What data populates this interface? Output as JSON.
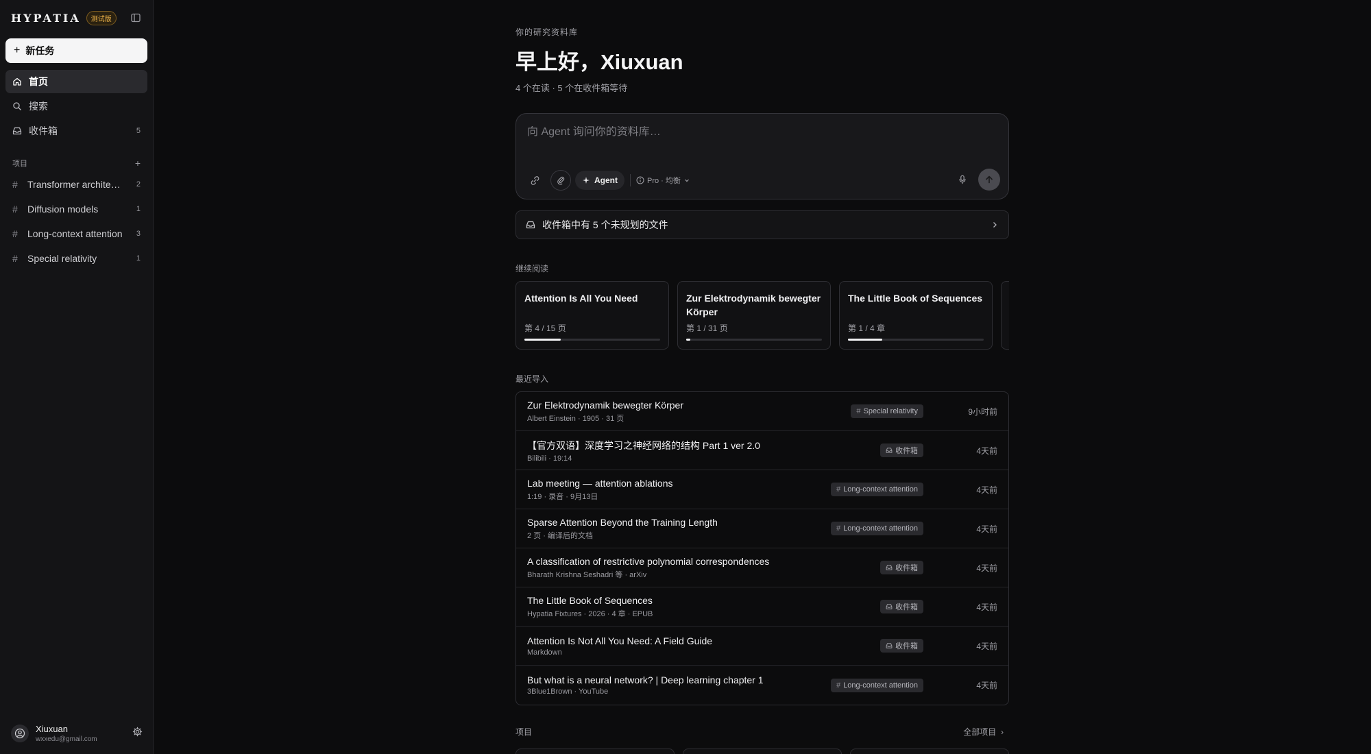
{
  "brand": {
    "logo": "HYPATIA",
    "badge": "测试版"
  },
  "sidebar": {
    "new_task": "新任务",
    "nav": [
      {
        "label": "首页",
        "icon": "home-icon",
        "active": true
      },
      {
        "label": "搜索",
        "icon": "search-icon"
      },
      {
        "label": "收件箱",
        "icon": "inbox-icon",
        "count": "5"
      }
    ],
    "projects_heading": "项目",
    "projects": [
      {
        "name": "Transformer architecture",
        "count": "2"
      },
      {
        "name": "Diffusion models",
        "count": "1"
      },
      {
        "name": "Long-context attention",
        "count": "3"
      },
      {
        "name": "Special relativity",
        "count": "1"
      }
    ],
    "user": {
      "name": "Xiuxuan",
      "email": "wxxedu@gmail.com"
    }
  },
  "main": {
    "eyebrow": "你的研究资料库",
    "greeting": "早上好，Xiuxuan",
    "summary": "4 个在读 · 5 个在收件箱等待",
    "composer": {
      "placeholder": "向 Agent 询问你的资料库…",
      "agent_label": "Agent",
      "model_label": "Pro · 均衡"
    },
    "inbox_banner": "收件箱中有 5 个未规划的文件",
    "continue_heading": "继续阅读",
    "continue": [
      {
        "title": "Attention Is All You Need",
        "meta": "第 4 / 15 页",
        "progress": 0.27
      },
      {
        "title": "Zur Elektrodynamik bewegter Körper",
        "meta": "第 1 / 31 页",
        "progress": 0.03
      },
      {
        "title": "The Little Book of Sequences",
        "meta": "第 1 / 4 章",
        "progress": 0.25
      }
    ],
    "recent_heading": "最近导入",
    "recent": [
      {
        "title": "Zur Elektrodynamik bewegter Körper",
        "sub": "Albert Einstein · 1905 · 31 页",
        "tag": "Special relativity",
        "tag_type": "project",
        "time": "9小时前"
      },
      {
        "title": "【官方双语】深度学习之神经网络的结构 Part 1 ver 2.0",
        "sub": "Bilibili · 19:14",
        "tag": "收件箱",
        "tag_type": "inbox",
        "time": "4天前"
      },
      {
        "title": "Lab meeting — attention ablations",
        "sub": "1:19 · 录音 · 9月13日",
        "tag": "Long-context attention",
        "tag_type": "project",
        "time": "4天前"
      },
      {
        "title": "Sparse Attention Beyond the Training Length",
        "sub": "2 页 · 编译后的文档",
        "tag": "Long-context attention",
        "tag_type": "project",
        "time": "4天前"
      },
      {
        "title": "A classification of restrictive polynomial correspondences",
        "sub": "Bharath Krishna Seshadri 等 · arXiv",
        "tag": "收件箱",
        "tag_type": "inbox",
        "time": "4天前"
      },
      {
        "title": "The Little Book of Sequences",
        "sub": "Hypatia Fixtures · 2026 · 4 章 · EPUB",
        "tag": "收件箱",
        "tag_type": "inbox",
        "time": "4天前"
      },
      {
        "title": "Attention Is Not All You Need: A Field Guide",
        "sub": "Markdown",
        "tag": "收件箱",
        "tag_type": "inbox",
        "time": "4天前"
      },
      {
        "title": "But what is a neural network? | Deep learning chapter 1",
        "sub": "3Blue1Brown · YouTube",
        "tag": "Long-context attention",
        "tag_type": "project",
        "time": "4天前"
      }
    ],
    "projects_heading": "项目",
    "all_projects": "全部项目"
  }
}
